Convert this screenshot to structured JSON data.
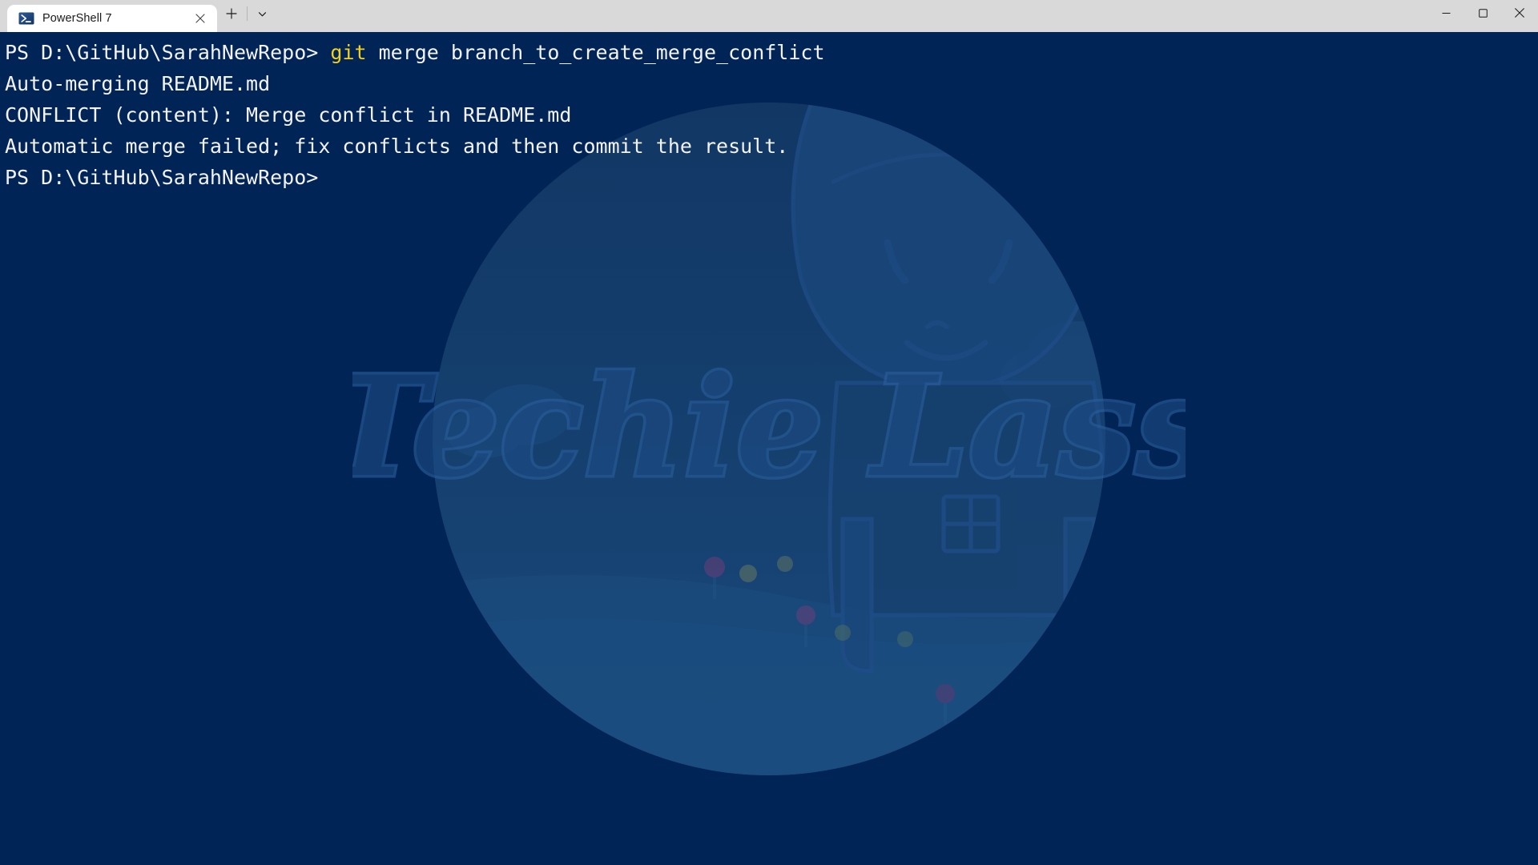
{
  "window": {
    "titlebar_bg": "#d9d9d9",
    "controls": [
      {
        "name": "minimize",
        "label": "─",
        "icon": "minimize-icon"
      },
      {
        "name": "maximize",
        "label": "☐",
        "icon": "maximize-icon"
      },
      {
        "name": "close",
        "label": "✕",
        "icon": "close-icon"
      }
    ]
  },
  "tabs": {
    "items": [
      {
        "title": "PowerShell 7",
        "icon": "powershell-icon",
        "active": true,
        "close_label": "✕"
      }
    ],
    "new_tab_label": "+",
    "dropdown_label": "⌄"
  },
  "terminal": {
    "background": "#012456",
    "foreground": "#f2f2f2",
    "accent_yellow": "#f3d020",
    "prompt": "PS D:\\GitHub\\SarahNewRepo>",
    "lines": [
      {
        "segments": [
          {
            "text": "PS D:\\GitHub\\SarahNewRepo> ",
            "color": "default"
          },
          {
            "text": "git",
            "color": "yellow"
          },
          {
            "text": " merge branch_to_create_merge_conflict",
            "color": "default"
          }
        ]
      },
      {
        "segments": [
          {
            "text": "Auto-merging README.md",
            "color": "default"
          }
        ]
      },
      {
        "segments": [
          {
            "text": "CONFLICT (content): Merge conflict in README.md",
            "color": "default"
          }
        ]
      },
      {
        "segments": [
          {
            "text": "Automatic merge failed; fix conflicts and then commit the result.",
            "color": "default"
          }
        ]
      },
      {
        "segments": [
          {
            "text": "PS D:\\GitHub\\SarahNewRepo> ",
            "color": "default"
          }
        ]
      }
    ]
  },
  "watermark": {
    "brand_text": "Techie Lass",
    "icon": "unicorn-watermark-icon",
    "circle_color": "#123765",
    "line_color": "#1f4c86",
    "fill_color": "#17406f"
  }
}
